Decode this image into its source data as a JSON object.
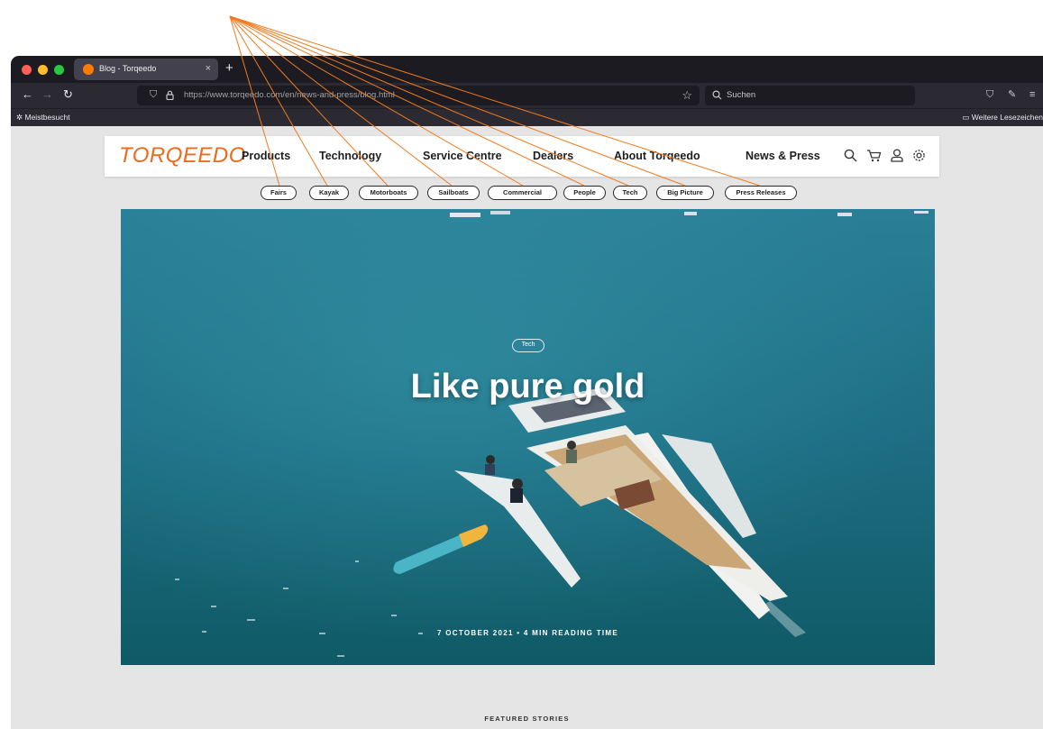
{
  "browser": {
    "tab_title": "Blog - Torqeedo",
    "tab_close": "×",
    "new_tab": "+",
    "url": "https://www.torqeedo.com/en/news-and-press/blog.html",
    "search_placeholder": "Suchen",
    "bookmark_left": "Meistbesucht",
    "bookmark_right": "Weitere Lesezeichen",
    "icons": [
      "back-icon",
      "forward-icon",
      "reload-icon",
      "shield-icon",
      "lock-icon",
      "star-icon",
      "search-icon",
      "pocket-icon",
      "extensions-icon",
      "menu-icon",
      "gear-icon",
      "folder-icon"
    ]
  },
  "site": {
    "logo": "TORQEEDO",
    "brand_color": "#ee6a1d",
    "nav": [
      "Products",
      "Technology",
      "Service Centre",
      "Dealers",
      "About Torqeedo",
      "News & Press"
    ],
    "header_icons": [
      "search-icon",
      "cart-icon",
      "user-icon",
      "settings-icon"
    ],
    "filters": [
      "Fairs",
      "Kayak",
      "Motorboats",
      "Sailboats",
      "Commercial",
      "People",
      "Tech",
      "Big Picture",
      "Press Releases"
    ]
  },
  "hero": {
    "tag": "Tech",
    "title": "Like pure gold",
    "meta": "7 OCTOBER 2021 • 4 MIN READING TIME"
  },
  "featured_label": "FEATURED STORIES",
  "annotation_color": "#f07a1e"
}
